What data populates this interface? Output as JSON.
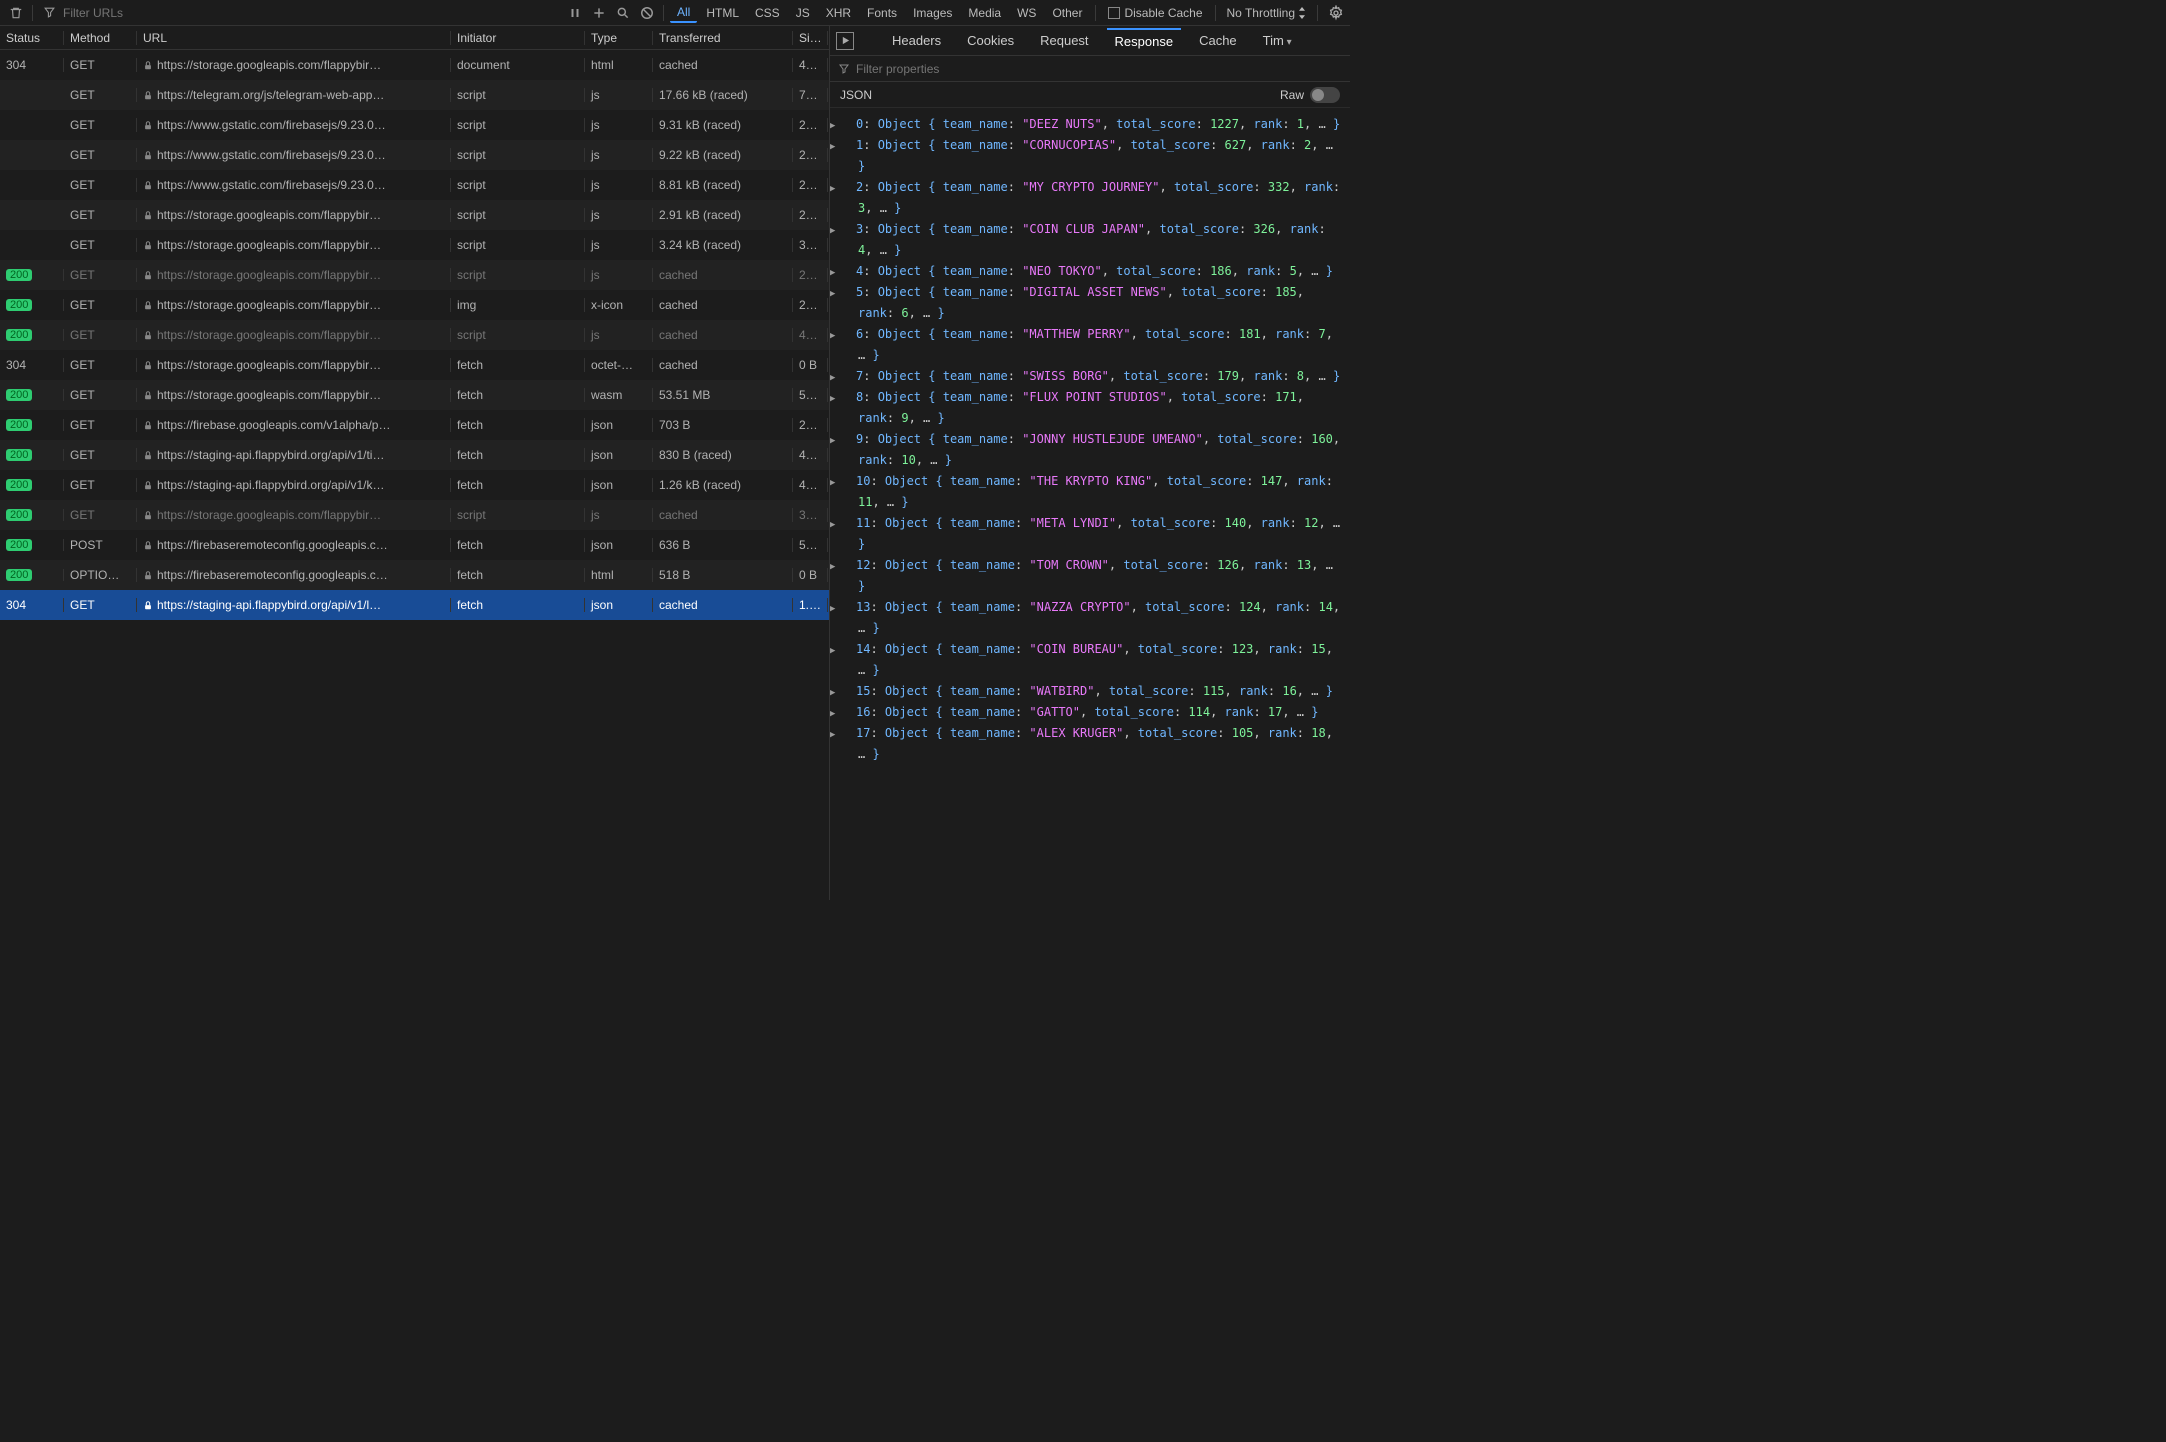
{
  "toolbar": {
    "filter_placeholder": "Filter URLs",
    "filters": [
      "All",
      "HTML",
      "CSS",
      "JS",
      "XHR",
      "Fonts",
      "Images",
      "Media",
      "WS",
      "Other"
    ],
    "active_filter": "All",
    "disable_cache": "Disable Cache",
    "throttling": "No Throttling"
  },
  "net_columns": {
    "status": "Status",
    "method": "Method",
    "url": "URL",
    "initiator": "Initiator",
    "type": "Type",
    "transferred": "Transferred",
    "size": "Si…"
  },
  "requests": [
    {
      "status": "304",
      "badge": false,
      "method": "GET",
      "url": "https://storage.googleapis.com/flappybir…",
      "initiator": "document",
      "type": "html",
      "transferred": "cached",
      "size": "4…",
      "selected": false,
      "faded": false
    },
    {
      "status": "",
      "badge": false,
      "method": "GET",
      "url": "https://telegram.org/js/telegram-web-app…",
      "initiator": "script",
      "type": "js",
      "transferred": "17.66 kB (raced)",
      "size": "7…",
      "selected": false,
      "faded": false
    },
    {
      "status": "",
      "badge": false,
      "method": "GET",
      "url": "https://www.gstatic.com/firebasejs/9.23.0…",
      "initiator": "script",
      "type": "js",
      "transferred": "9.31 kB (raced)",
      "size": "2…",
      "selected": false,
      "faded": false
    },
    {
      "status": "",
      "badge": false,
      "method": "GET",
      "url": "https://www.gstatic.com/firebasejs/9.23.0…",
      "initiator": "script",
      "type": "js",
      "transferred": "9.22 kB (raced)",
      "size": "2…",
      "selected": false,
      "faded": false
    },
    {
      "status": "",
      "badge": false,
      "method": "GET",
      "url": "https://www.gstatic.com/firebasejs/9.23.0…",
      "initiator": "script",
      "type": "js",
      "transferred": "8.81 kB (raced)",
      "size": "2…",
      "selected": false,
      "faded": false
    },
    {
      "status": "",
      "badge": false,
      "method": "GET",
      "url": "https://storage.googleapis.com/flappybir…",
      "initiator": "script",
      "type": "js",
      "transferred": "2.91 kB (raced)",
      "size": "2…",
      "selected": false,
      "faded": false
    },
    {
      "status": "",
      "badge": false,
      "method": "GET",
      "url": "https://storage.googleapis.com/flappybir…",
      "initiator": "script",
      "type": "js",
      "transferred": "3.24 kB (raced)",
      "size": "3…",
      "selected": false,
      "faded": false
    },
    {
      "status": "200",
      "badge": true,
      "method": "GET",
      "url": "https://storage.googleapis.com/flappybir…",
      "initiator": "script",
      "type": "js",
      "transferred": "cached",
      "size": "2…",
      "selected": false,
      "faded": true
    },
    {
      "status": "200",
      "badge": true,
      "method": "GET",
      "url": "https://storage.googleapis.com/flappybir…",
      "initiator": "img",
      "type": "x-icon",
      "transferred": "cached",
      "size": "2…",
      "selected": false,
      "faded": false
    },
    {
      "status": "200",
      "badge": true,
      "method": "GET",
      "url": "https://storage.googleapis.com/flappybir…",
      "initiator": "script",
      "type": "js",
      "transferred": "cached",
      "size": "4…",
      "selected": false,
      "faded": true
    },
    {
      "status": "304",
      "badge": false,
      "method": "GET",
      "url": "https://storage.googleapis.com/flappybir…",
      "initiator": "fetch",
      "type": "octet-…",
      "transferred": "cached",
      "size": "0 B",
      "selected": false,
      "faded": false
    },
    {
      "status": "200",
      "badge": true,
      "method": "GET",
      "url": "https://storage.googleapis.com/flappybir…",
      "initiator": "fetch",
      "type": "wasm",
      "transferred": "53.51 MB",
      "size": "5…",
      "selected": false,
      "faded": false
    },
    {
      "status": "200",
      "badge": true,
      "method": "GET",
      "url": "https://firebase.googleapis.com/v1alpha/p…",
      "initiator": "fetch",
      "type": "json",
      "transferred": "703 B",
      "size": "2…",
      "selected": false,
      "faded": false
    },
    {
      "status": "200",
      "badge": true,
      "method": "GET",
      "url": "https://staging-api.flappybird.org/api/v1/ti…",
      "initiator": "fetch",
      "type": "json",
      "transferred": "830 B (raced)",
      "size": "4…",
      "selected": false,
      "faded": false
    },
    {
      "status": "200",
      "badge": true,
      "method": "GET",
      "url": "https://staging-api.flappybird.org/api/v1/k…",
      "initiator": "fetch",
      "type": "json",
      "transferred": "1.26 kB (raced)",
      "size": "4…",
      "selected": false,
      "faded": false
    },
    {
      "status": "200",
      "badge": true,
      "method": "GET",
      "url": "https://storage.googleapis.com/flappybir…",
      "initiator": "script",
      "type": "js",
      "transferred": "cached",
      "size": "3…",
      "selected": false,
      "faded": true
    },
    {
      "status": "200",
      "badge": true,
      "method": "POST",
      "url": "https://firebaseremoteconfig.googleapis.c…",
      "initiator": "fetch",
      "type": "json",
      "transferred": "636 B",
      "size": "5…",
      "selected": false,
      "faded": false
    },
    {
      "status": "200",
      "badge": true,
      "method": "OPTIO…",
      "url": "https://firebaseremoteconfig.googleapis.c…",
      "initiator": "fetch",
      "type": "html",
      "transferred": "518 B",
      "size": "0 B",
      "selected": false,
      "faded": false
    },
    {
      "status": "304",
      "badge": false,
      "method": "GET",
      "url": "https://staging-api.flappybird.org/api/v1/l…",
      "initiator": "fetch",
      "type": "json",
      "transferred": "cached",
      "size": "1.…",
      "selected": true,
      "faded": false
    }
  ],
  "detail_tabs": {
    "headers": "Headers",
    "cookies": "Cookies",
    "request": "Request",
    "response": "Response",
    "cache": "Cache",
    "timings": "Tim"
  },
  "active_detail_tab": "Response",
  "filter_properties_placeholder": "Filter properties",
  "json_label": "JSON",
  "raw_label": "Raw",
  "response_items": [
    {
      "idx": 0,
      "team_name": "DEEZ NUTS",
      "total_score": 1227,
      "rank": 1,
      "wraps": false
    },
    {
      "idx": 1,
      "team_name": "CORNUCOPIAS",
      "total_score": 627,
      "rank": 2,
      "wraps": false
    },
    {
      "idx": 2,
      "team_name": "MY CRYPTO JOURNEY",
      "total_score": 332,
      "rank": 3,
      "wraps": true
    },
    {
      "idx": 3,
      "team_name": "COIN CLUB JAPAN",
      "total_score": 326,
      "rank": 4,
      "wraps": true,
      "trail": true
    },
    {
      "idx": 4,
      "team_name": "NEO TOKYO",
      "total_score": 186,
      "rank": 5,
      "wraps": false
    },
    {
      "idx": 5,
      "team_name": "DIGITAL ASSET NEWS",
      "total_score": 185,
      "rank": 6,
      "wraps": true
    },
    {
      "idx": 6,
      "team_name": "MATTHEW PERRY",
      "total_score": 181,
      "rank": 7,
      "wraps": false,
      "trail": true
    },
    {
      "idx": 7,
      "team_name": "SWISS BORG",
      "total_score": 179,
      "rank": 8,
      "wraps": false
    },
    {
      "idx": 8,
      "team_name": "FLUX POINT STUDIOS",
      "total_score": 171,
      "rank": 9,
      "wraps": true
    },
    {
      "idx": 9,
      "team_name": "JONNY HUSTLEJUDE UMEANO",
      "total_score": 160,
      "rank": 10,
      "wraps": true
    },
    {
      "idx": 10,
      "team_name": "THE KRYPTO KING",
      "total_score": 147,
      "rank": 11,
      "wraps": true,
      "trail": true
    },
    {
      "idx": 11,
      "team_name": "META LYNDI",
      "total_score": 140,
      "rank": 12,
      "wraps": false
    },
    {
      "idx": 12,
      "team_name": "TOM CROWN",
      "total_score": 126,
      "rank": 13,
      "wraps": false,
      "trail": true
    },
    {
      "idx": 13,
      "team_name": "NAZZA CRYPTO",
      "total_score": 124,
      "rank": 14,
      "wraps": true,
      "trail": true
    },
    {
      "idx": 14,
      "team_name": "COIN BUREAU",
      "total_score": 123,
      "rank": 15,
      "wraps": false,
      "trail": true
    },
    {
      "idx": 15,
      "team_name": "WATBIRD",
      "total_score": 115,
      "rank": 16,
      "wraps": false
    },
    {
      "idx": 16,
      "team_name": "GATTO",
      "total_score": 114,
      "rank": 17,
      "wraps": false
    },
    {
      "idx": 17,
      "team_name": "ALEX KRUGER",
      "total_score": 105,
      "rank": 18,
      "wraps": false,
      "trail": true
    }
  ]
}
